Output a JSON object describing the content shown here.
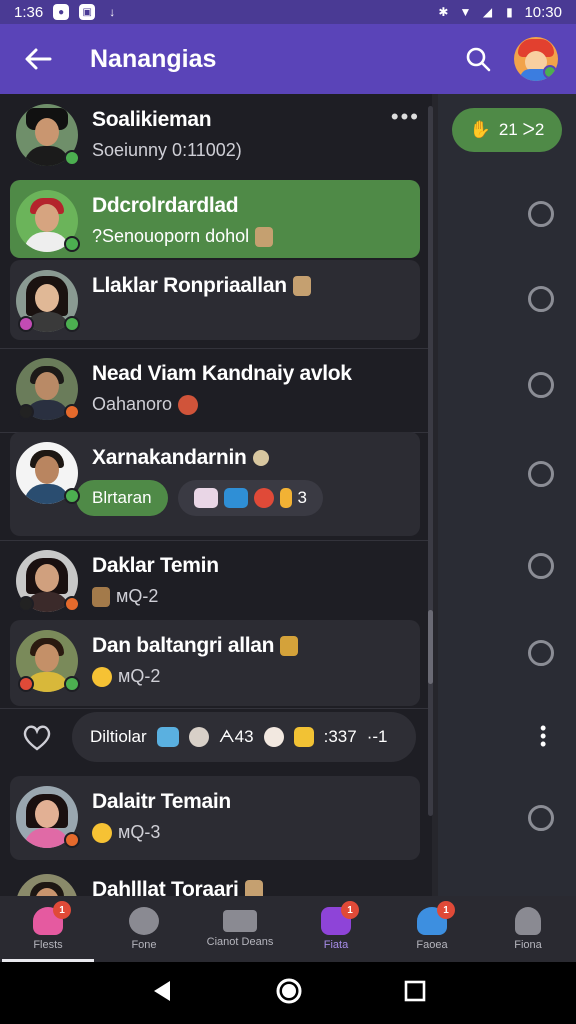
{
  "status_bar": {
    "left_time": "1:36",
    "right_time": "10:30",
    "icons": [
      "circle-record-icon",
      "app-box-icon",
      "download-icon",
      "bluetooth-icon",
      "wifi-icon",
      "signal-icon",
      "battery-icon"
    ]
  },
  "header": {
    "title": "Nanangias",
    "icons": [
      "back-arrow-icon",
      "search-icon",
      "profile-avatar"
    ]
  },
  "chats": [
    {
      "name": "Soalikieman",
      "preview": "Soeiunny 0:11002)",
      "badge_color": "#4caf50"
    },
    {
      "name": "Ddcrolrdardlad",
      "preview": "?Senouoporn dohol",
      "active": true
    },
    {
      "name": "Llaklar Ronpriaallan",
      "preview": ""
    },
    {
      "name": "Nead Viam Kandnaiy avlok",
      "preview": "Oahanoro"
    },
    {
      "name": "Xarnakandarnin",
      "pill": "Blrtaran",
      "reaction_count": "3"
    },
    {
      "name": "Daklar Temin",
      "preview": "ᴍQ-2"
    },
    {
      "name": "Dan baltangri allan",
      "preview": "ᴍQ-2"
    },
    {
      "name": "Dalaitr Temain",
      "preview": "ᴍQ-3"
    },
    {
      "name": "Dahlllat Toraari",
      "preview": ""
    }
  ],
  "summary": {
    "label": "Diltiolar",
    "code1": "ᗅ43",
    "code2": ":337",
    "code3": "·-1"
  },
  "side": {
    "count_label": "21 ᐳ2"
  },
  "bottom_nav": [
    {
      "label": "Flests",
      "badge": "1",
      "color": "#e55aa0"
    },
    {
      "label": "Fone",
      "badge": "",
      "color": "#8a8a92"
    },
    {
      "label": "Cianot Deans",
      "badge": "",
      "color": "#8a8a92"
    },
    {
      "label": "Fiata",
      "badge": "1",
      "color": "#8e44d8",
      "active": true
    },
    {
      "label": "Faoea",
      "badge": "1",
      "color": "#3d8fe0"
    },
    {
      "label": "Fiona",
      "badge": "",
      "color": "#8a8a92"
    }
  ],
  "colors": {
    "accent_purple": "#5a44b8",
    "accent_green": "#4f8a47",
    "background": "#1e1e24"
  }
}
